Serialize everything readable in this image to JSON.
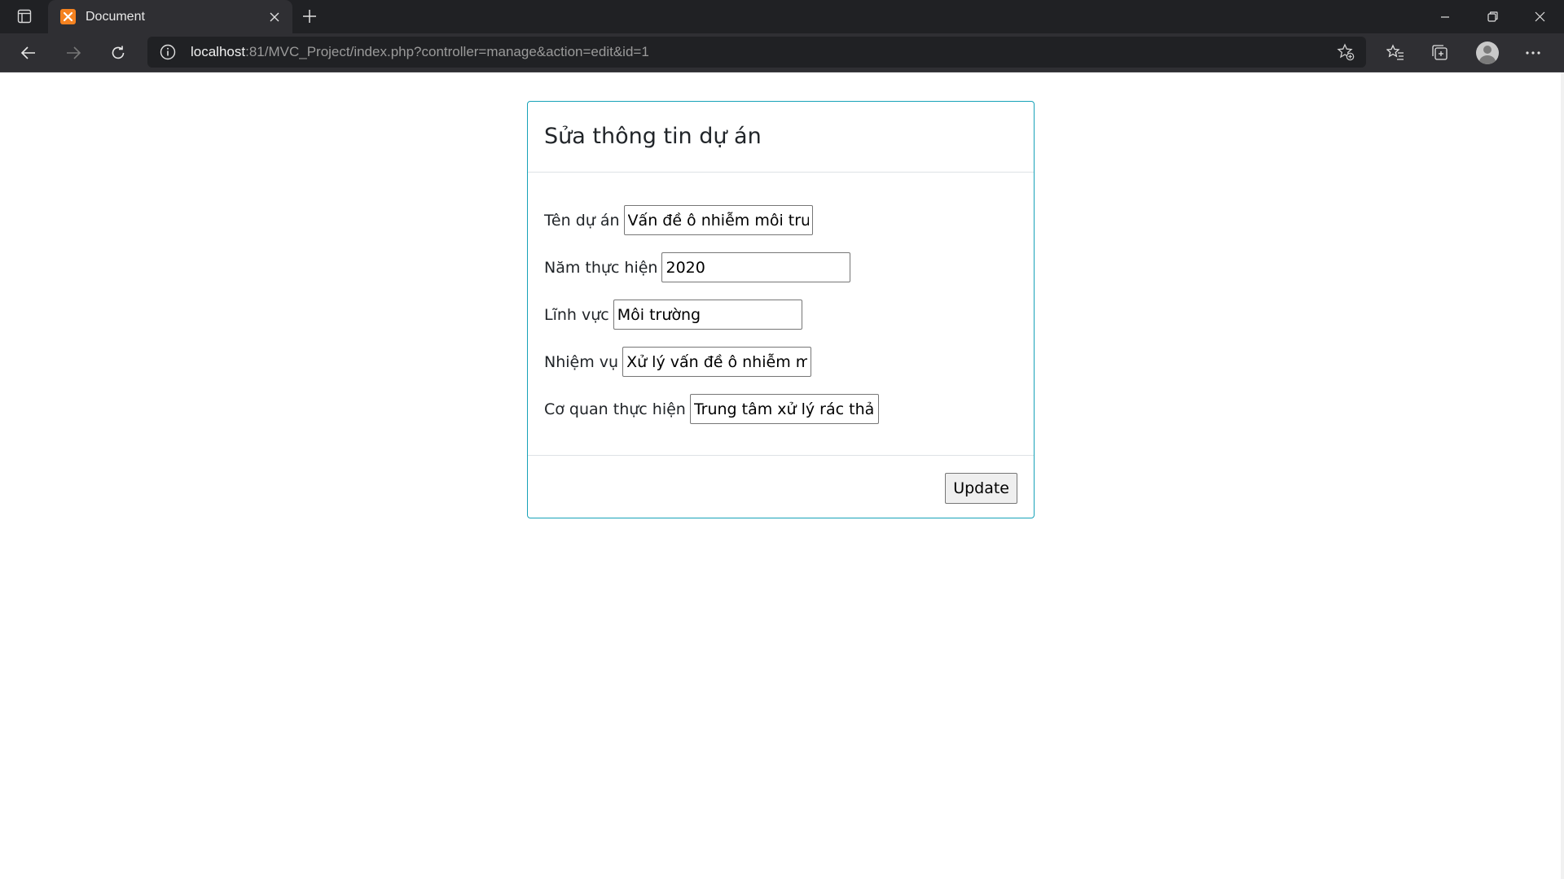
{
  "browser": {
    "tab_title": "Document",
    "url_host": "localhost",
    "url_rest": ":81/MVC_Project/index.php?controller=manage&action=edit&id=1",
    "icons": {
      "tab_actions": "tab-actions-icon",
      "favicon": "xampp-icon",
      "close": "close-icon",
      "new_tab": "plus-icon",
      "back": "back-arrow-icon",
      "forward": "forward-arrow-icon",
      "refresh": "refresh-icon",
      "info": "info-icon",
      "add_favorite": "star-plus-icon",
      "favorites": "favorites-icon",
      "collections": "collections-icon",
      "profile": "profile-icon",
      "more": "ellipsis-icon"
    }
  },
  "form": {
    "title": "Sửa thông tin dự án",
    "fields": [
      {
        "label": "Tên dự án",
        "value": "Vấn đề ô nhiễm môi trường"
      },
      {
        "label": "Năm thực hiện",
        "value": "2020"
      },
      {
        "label": "Lĩnh vực",
        "value": "Môi trường"
      },
      {
        "label": "Nhiệm vụ",
        "value": "Xử lý vấn đề ô nhiễm môi trường"
      },
      {
        "label": "Cơ quan thực hiện",
        "value": "Trung tâm xử lý rác thải"
      }
    ],
    "submit_label": "Update"
  },
  "colors": {
    "card_border": "#17a2b8",
    "titlebar_bg": "#202124",
    "toolbar_bg": "#2f2f33"
  }
}
